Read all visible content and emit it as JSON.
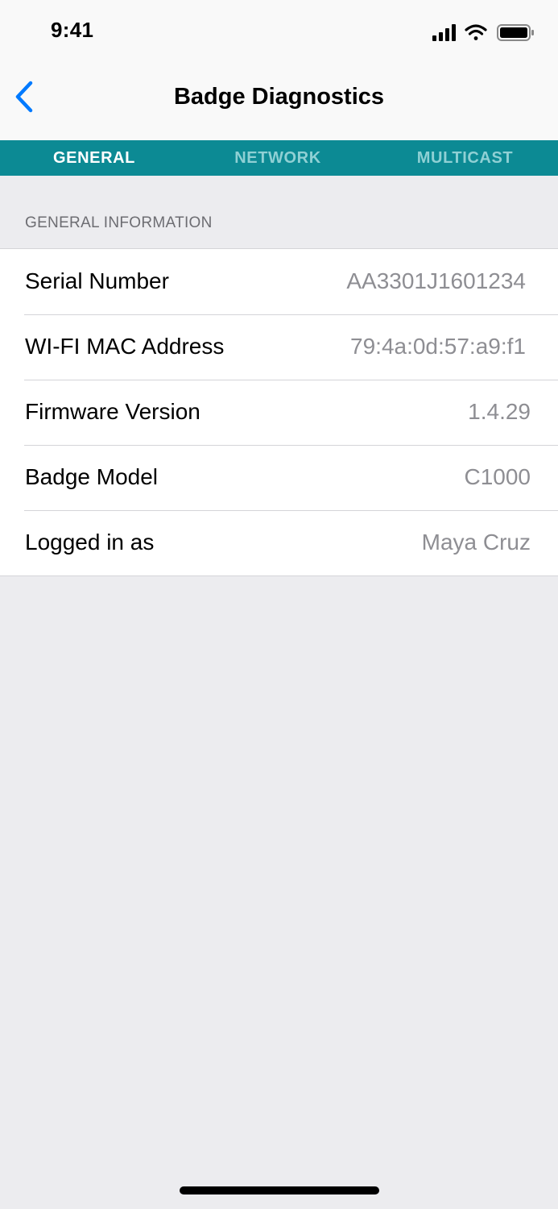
{
  "status_bar": {
    "time": "9:41",
    "icons": [
      "signal-icon",
      "wifi-icon",
      "battery-icon"
    ]
  },
  "nav": {
    "title": "Badge Diagnostics",
    "back_icon": "chevron-left-icon",
    "accent_color": "#007aff"
  },
  "tabs": [
    {
      "label": "GENERAL",
      "active": true
    },
    {
      "label": "NETWORK",
      "active": false
    },
    {
      "label": "MULTICAST",
      "active": false
    }
  ],
  "tab_bar_color": "#0c8a94",
  "section": {
    "header": "GENERAL INFORMATION",
    "rows": [
      {
        "label": "Serial Number",
        "value": "AA3301J1601234"
      },
      {
        "label": "WI-FI MAC Address",
        "value": "79:4a:0d:57:a9:f1"
      },
      {
        "label": "Firmware Version",
        "value": "1.4.29"
      },
      {
        "label": "Badge Model",
        "value": "C1000"
      },
      {
        "label": "Logged in as",
        "value": "Maya Cruz"
      }
    ]
  }
}
